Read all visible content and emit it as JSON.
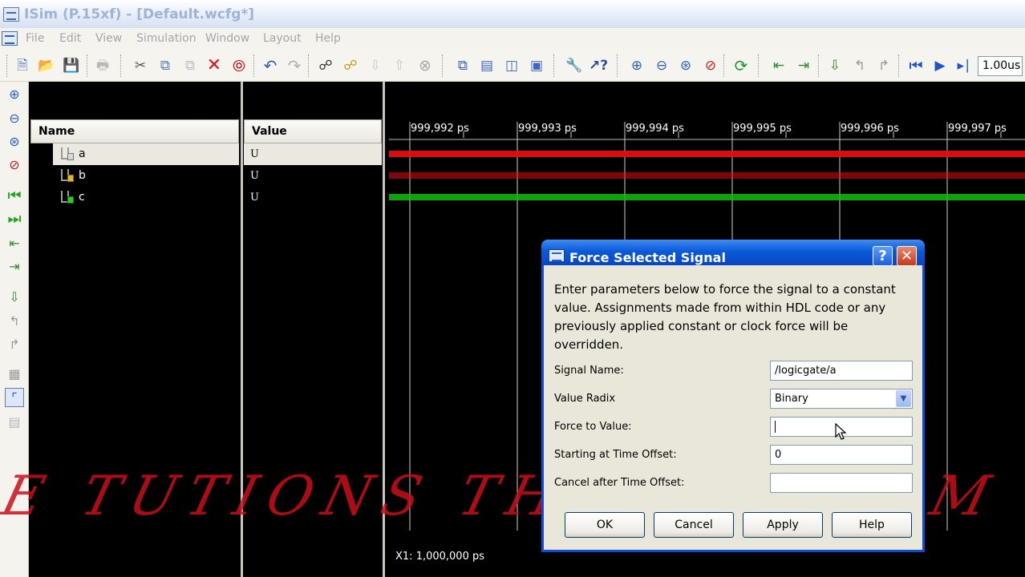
{
  "window": {
    "title": "ISim (P.15xf) - [Default.wcfg*]"
  },
  "menu": [
    "File",
    "Edit",
    "View",
    "Simulation",
    "Window",
    "Layout",
    "Help"
  ],
  "toolbar": {
    "buttons": [
      "new-icon",
      "open-icon",
      "save-icon",
      "print-icon",
      "cut-icon",
      "copy-icon",
      "paste-icon",
      "delete-icon",
      "stop-icon",
      "undo-icon",
      "redo-icon",
      "find-icon",
      "find-next-icon",
      "arrow-down-icon",
      "arrow-up-icon",
      "cancel-icon",
      "cascade-icon",
      "tile-horizontal-icon",
      "tile-vertical-icon",
      "float-icon",
      "settings-icon",
      "context-help-icon",
      "zoom-in-icon",
      "zoom-out-icon",
      "zoom-fit-icon",
      "zoom-full-icon",
      "refresh-icon",
      "restart-icon",
      "run-all-icon",
      "run-icon",
      "step-back-icon",
      "step-forward-icon",
      "relaunch-icon",
      "play-icon",
      "run-for-icon"
    ],
    "time_value": "1.00us"
  },
  "left_tools": [
    "zoom-in-icon",
    "zoom-out-icon",
    "zoom-fit-icon",
    "zoom-cursor-icon",
    "go-to-start-icon",
    "go-to-end-icon",
    "previous-transition-icon",
    "next-transition-icon",
    "add-marker-icon",
    "previous-marker-icon",
    "next-marker-icon",
    "swap-cursors-icon",
    "snap-to-transition-icon",
    "floating-ruler-icon"
  ],
  "signals": {
    "name_header": "Name",
    "value_header": "Value",
    "rows": [
      {
        "name": "a",
        "value": "U",
        "selected": true
      },
      {
        "name": "b",
        "value": "U",
        "selected": false
      },
      {
        "name": "c",
        "value": "U",
        "selected": false
      }
    ]
  },
  "waveform": {
    "ticks": [
      "999,992 ps",
      "999,993 ps",
      "999,994 ps",
      "999,995 ps",
      "999,996 ps",
      "999,997 ps"
    ],
    "cursor_readout": "X1: 1,000,000 ps",
    "colors": {
      "undefined": "#e01010",
      "forced": "#10c010"
    }
  },
  "watermark": {
    "text": "E TUTIONS THEN CALL M"
  },
  "dialog": {
    "title": "Force Selected Signal",
    "description": "Enter parameters below to force the signal to a constant value. Assignments made from within HDL code or any previously applied constant or clock force will be overridden.",
    "fields": {
      "signal_name": {
        "label": "Signal Name:",
        "value": "/logicgate/a"
      },
      "value_radix": {
        "label": "Value Radix",
        "value": "Binary"
      },
      "force_value": {
        "label": "Force to Value:",
        "value": ""
      },
      "start_offset": {
        "label": "Starting at Time Offset:",
        "value": "0"
      },
      "cancel_offset": {
        "label": "Cancel after Time Offset:",
        "value": ""
      }
    },
    "buttons": {
      "ok": "OK",
      "cancel": "Cancel",
      "apply": "Apply",
      "help": "Help"
    }
  }
}
